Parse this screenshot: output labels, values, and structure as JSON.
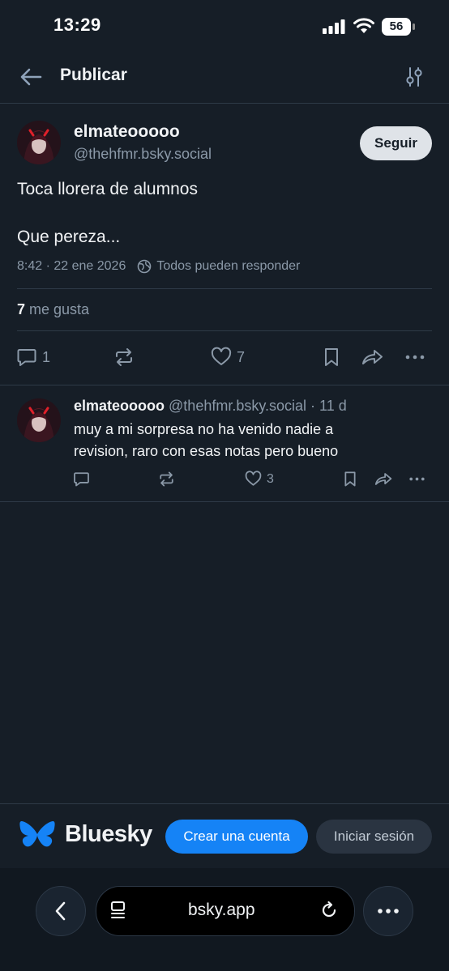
{
  "status_bar": {
    "time": "13:29",
    "battery": "56"
  },
  "header": {
    "title": "Publicar"
  },
  "post": {
    "author": "elmateooooo",
    "handle": "@thehfmr.bsky.social",
    "follow_label": "Seguir",
    "text_line1": "Toca llorera de alumnos",
    "text_line2": "Que pereza...",
    "timestamp": "8:42 · 22 ene 2026",
    "reply_setting": "Todos pueden responder",
    "likes_count": "7",
    "likes_label": "me gusta",
    "actions": {
      "replies": "1",
      "likes": "7"
    }
  },
  "reply": {
    "author": "elmateooooo",
    "handle": "@thehfmr.bsky.social",
    "time": "· 11 d",
    "text_line1": "muy a mi sorpresa no ha venido nadie a",
    "text_line2": "revision, raro con esas notas pero bueno",
    "actions": {
      "likes": "3"
    }
  },
  "bottom_bar": {
    "brand": "Bluesky",
    "signup_label": "Crear una cuenta",
    "login_label": "Iniciar sesión"
  },
  "browser": {
    "url": "bsky.app"
  },
  "colors": {
    "accent": "#1583f6",
    "background": "#161e27",
    "muted": "#8b99a8"
  }
}
